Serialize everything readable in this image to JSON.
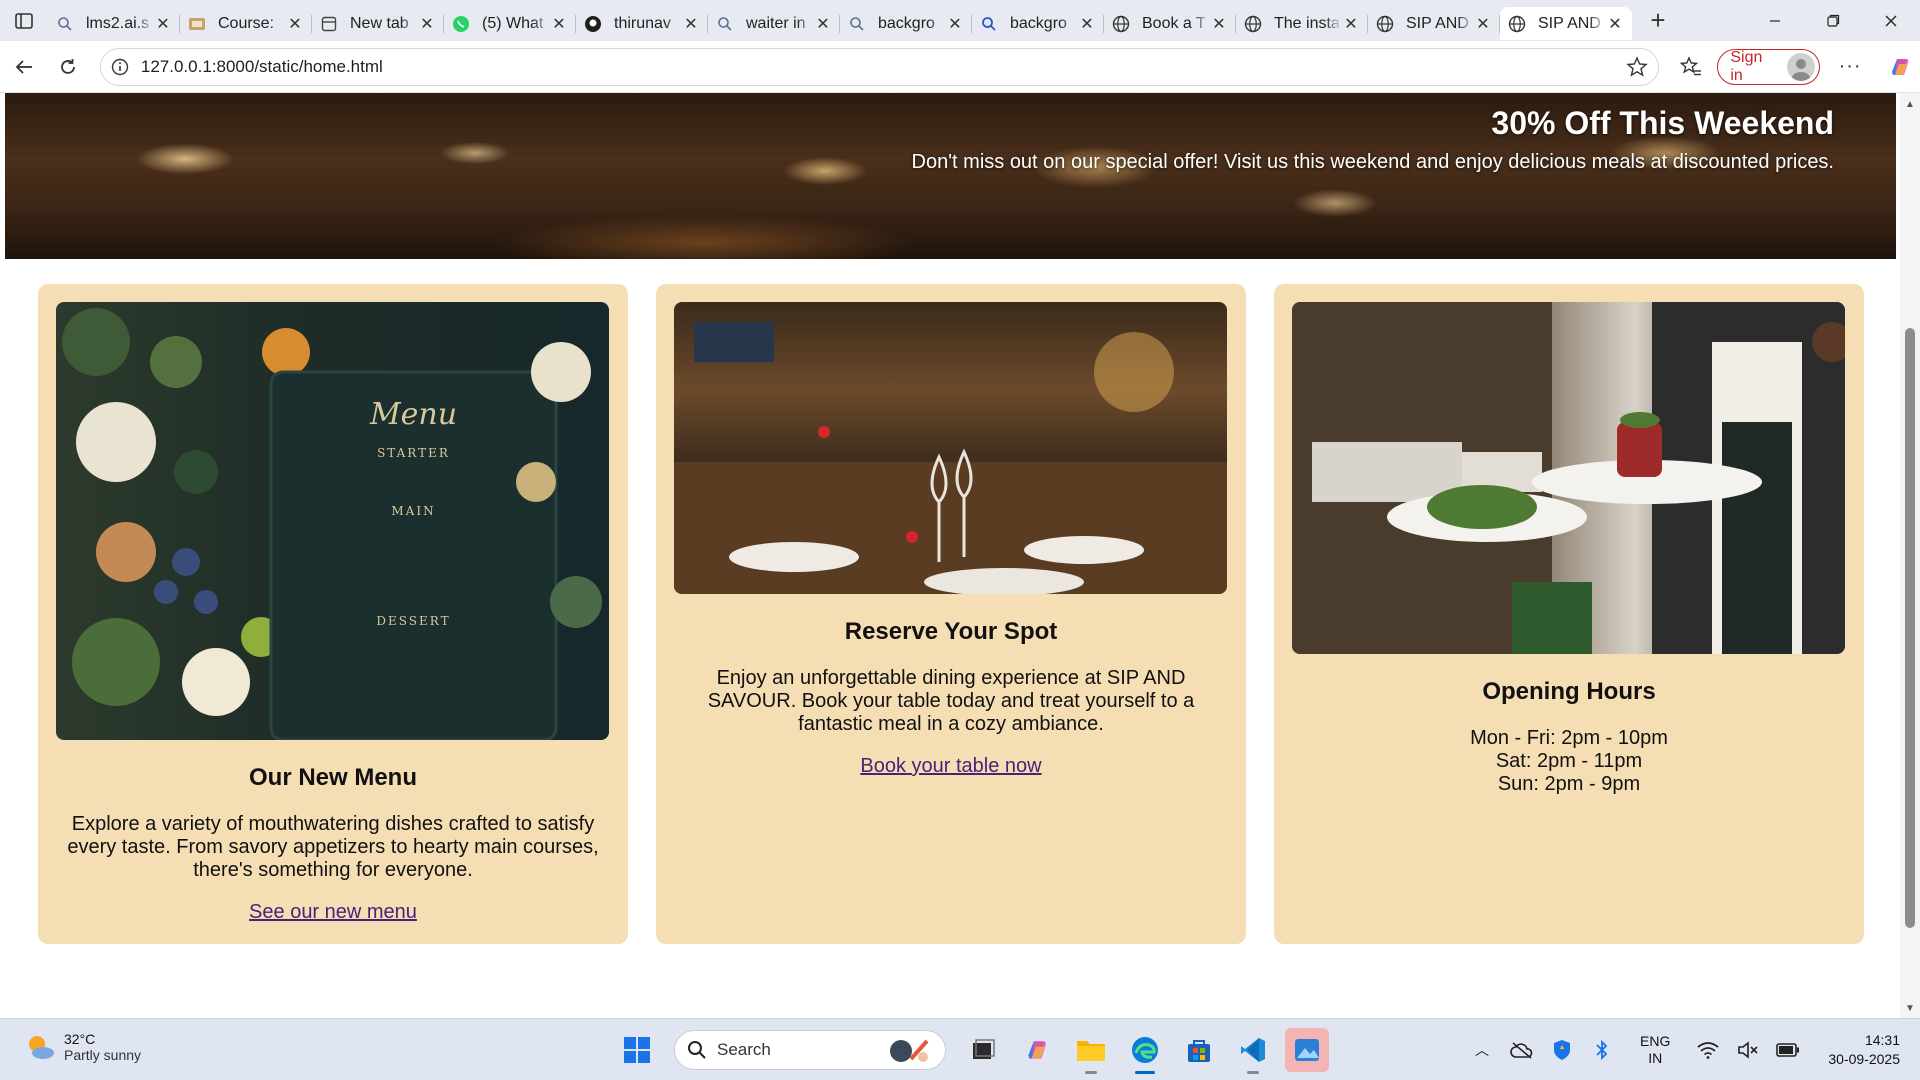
{
  "browser": {
    "tabs": [
      {
        "title": "lms2.ai.s",
        "icon": "search-favicon",
        "active": false
      },
      {
        "title": "Course:",
        "icon": "course-favicon",
        "active": false
      },
      {
        "title": "New tab",
        "icon": "newtab-favicon",
        "active": false
      },
      {
        "title": "(5) What",
        "icon": "whatsapp-favicon",
        "active": false
      },
      {
        "title": "thirunav",
        "icon": "github-favicon",
        "active": false
      },
      {
        "title": "waiter in",
        "icon": "search-favicon",
        "active": false
      },
      {
        "title": "backgro",
        "icon": "search-favicon",
        "active": false
      },
      {
        "title": "backgro",
        "icon": "search-favicon",
        "active": false
      },
      {
        "title": "Book a T",
        "icon": "globe-favicon",
        "active": false
      },
      {
        "title": "The insta",
        "icon": "globe-favicon",
        "active": false
      },
      {
        "title": "SIP AND",
        "icon": "globe-favicon",
        "active": false
      },
      {
        "title": "SIP AND",
        "icon": "globe-favicon",
        "active": true
      }
    ],
    "url": "127.0.0.1:8000/static/home.html",
    "signin_label": "Sign in"
  },
  "page": {
    "hero": {
      "title": "30% Off This Weekend",
      "subtitle": "Don't miss out on our special offer! Visit us this weekend and enjoy delicious meals at discounted prices."
    },
    "cards": [
      {
        "heading": "Our New Menu",
        "text": "Explore a variety of mouthwatering dishes crafted to satisfy every taste. From savory appetizers to hearty main courses, there's something for everyone.",
        "link": "See our new menu",
        "menu_board": {
          "title": "Menu",
          "starter": "STARTER",
          "main": "MAIN",
          "dessert": "DESSERT"
        }
      },
      {
        "heading": "Reserve Your Spot",
        "text": "Enjoy an unforgettable dining experience at SIP AND SAVOUR. Book your table today and treat yourself to a fantastic meal in a cozy ambiance.",
        "link": "Book your table now"
      },
      {
        "heading": "Opening Hours",
        "hours": [
          "Mon - Fri: 2pm - 10pm",
          "Sat: 2pm - 11pm",
          "Sun: 2pm - 9pm"
        ]
      }
    ]
  },
  "taskbar": {
    "weather": {
      "temp": "32°C",
      "desc": "Partly sunny"
    },
    "search_placeholder": "Search",
    "lang": {
      "line1": "ENG",
      "line2": "IN"
    },
    "clock": {
      "time": "14:31",
      "date": "30-09-2025"
    }
  },
  "colors": {
    "card_bg": "#f6deb4",
    "link": "#4b2079",
    "signin": "#c4262e",
    "accent": "#0067c0"
  }
}
